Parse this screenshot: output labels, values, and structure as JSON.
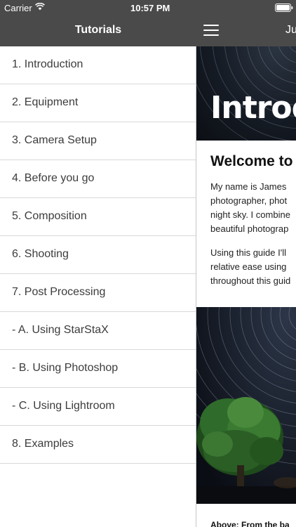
{
  "status_bar": {
    "carrier": "Carrier",
    "time": "10:57 PM"
  },
  "drawer": {
    "title": "Tutorials",
    "items": [
      {
        "label": "1. Introduction"
      },
      {
        "label": "2. Equipment"
      },
      {
        "label": "3. Camera Setup"
      },
      {
        "label": "4. Before you go"
      },
      {
        "label": "5. Composition"
      },
      {
        "label": "6. Shooting"
      },
      {
        "label": "7. Post Processing"
      },
      {
        "label": "- A. Using StarStaX"
      },
      {
        "label": "- B. Using Photoshop"
      },
      {
        "label": "- C. Using Lightroom"
      },
      {
        "label": "8. Examples"
      }
    ]
  },
  "main": {
    "header_title": "Ju",
    "banner_title": "Introdu",
    "heading": "Welcome to",
    "paragraph_1": [
      "My name is James",
      "photographer, phot",
      "night sky. I combine",
      "beautiful photograp"
    ],
    "paragraph_2": [
      "Using this guide I'll",
      "relative ease using",
      "throughout this guid"
    ],
    "caption": "Above: From the ba"
  },
  "colors": {
    "header_bg": "#4a4a4a",
    "divider": "#d9d9d9",
    "menu_text": "#3c3c3c"
  },
  "icons": {
    "wifi": "wifi-icon",
    "battery": "battery-icon",
    "menu": "hamburger-menu-icon"
  }
}
